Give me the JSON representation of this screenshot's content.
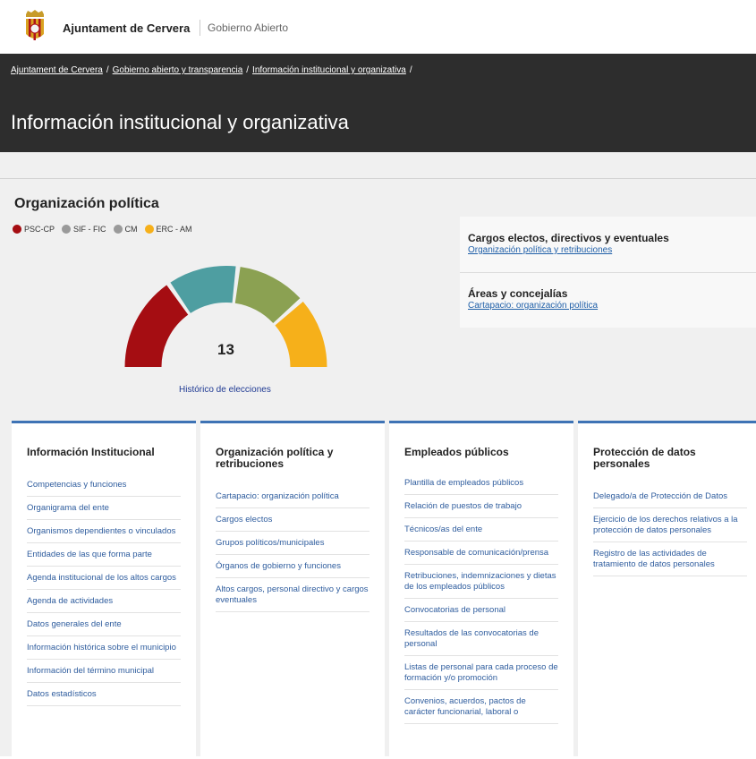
{
  "header": {
    "brand": "Ajuntament de Cervera",
    "subtitle": "Gobierno Abierto"
  },
  "breadcrumb": [
    "Ajuntament de Cervera",
    "Gobierno abierto y transparencia",
    "Información institucional y organizativa"
  ],
  "page_title": "Información institucional y organizativa",
  "organization": {
    "title": "Organización política",
    "legend": [
      {
        "label": "PSC-CP",
        "color": "#a50d12"
      },
      {
        "label": "SIF - FIC",
        "color": "#9a9a9a"
      },
      {
        "label": "CM",
        "color": "#9a9a9a"
      },
      {
        "label": "ERC - AM",
        "color": "#f6b01a"
      }
    ],
    "seats_total": "13",
    "gauge_segments": [
      {
        "color": "#a50d12",
        "seats": 4
      },
      {
        "color": "#4e9ea1",
        "seats": 3
      },
      {
        "color": "#8ba152",
        "seats": 3
      },
      {
        "color": "#f6b01a",
        "seats": 3
      }
    ],
    "history_link": "Histórico de elecciones"
  },
  "side_panel": [
    {
      "title": "Cargos electos, directivos y eventuales",
      "link": "Organización política y retribuciones"
    },
    {
      "title": "Áreas y concejalías",
      "link": "Cartapacio: organización política"
    }
  ],
  "columns": [
    {
      "title": "Información Institucional",
      "items": [
        "Competencias y funciones",
        "Organigrama del ente",
        "Organismos dependientes o vinculados",
        "Entidades de las que forma parte",
        "Agenda institucional de los altos cargos",
        "Agenda de actividades",
        "Datos generales del ente",
        "Información histórica sobre el municipio",
        "Información del término municipal",
        "Datos estadísticos"
      ]
    },
    {
      "title": "Organización política y retribuciones",
      "items": [
        "Cartapacio: organización política",
        "Cargos electos",
        "Grupos políticos/municipales",
        "Órganos de gobierno y funciones",
        "Altos cargos, personal directivo y cargos eventuales"
      ]
    },
    {
      "title": "Empleados públicos",
      "items": [
        "Plantilla de empleados públicos",
        "Relación de puestos de trabajo",
        "Técnicos/as del ente",
        "Responsable de comunicación/prensa",
        "Retribuciones, indemnizaciones y dietas de los empleados públicos",
        "Convocatorias de personal",
        "Resultados de las convocatorias de personal",
        "Listas de personal para cada proceso de formación y/o promoción",
        "Convenios, acuerdos, pactos de carácter funcionarial, laboral o"
      ]
    },
    {
      "title": "Protección de datos personales",
      "items": [
        "Delegado/a de Protección de Datos",
        "Ejercicio de los derechos relativos a la protección de datos personales",
        "Registro de las actividades de tratamiento de datos personales"
      ]
    }
  ]
}
